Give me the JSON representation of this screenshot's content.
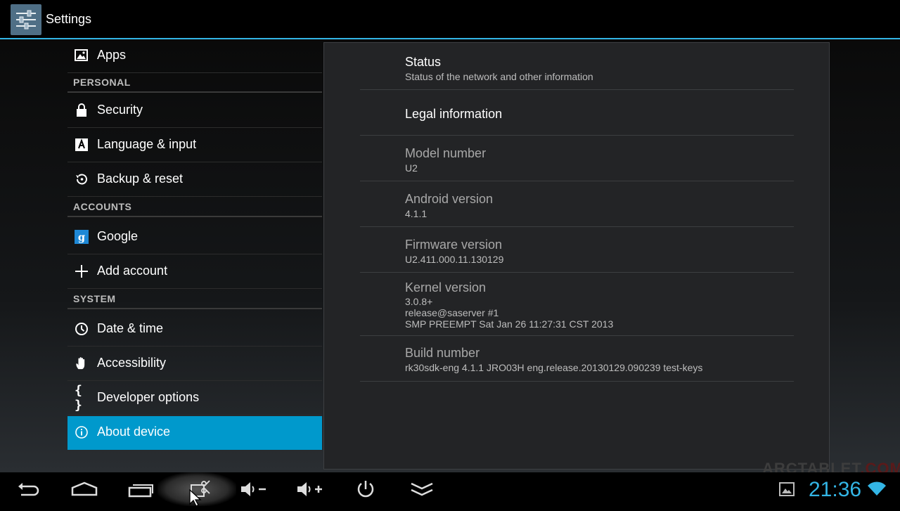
{
  "action_bar": {
    "title": "Settings"
  },
  "nav": {
    "apps": "Apps",
    "sections": {
      "personal": "PERSONAL",
      "accounts": "ACCOUNTS",
      "system": "SYSTEM"
    },
    "security": "Security",
    "language": "Language & input",
    "backup": "Backup & reset",
    "google": "Google",
    "add_account": "Add account",
    "date_time": "Date & time",
    "accessibility": "Accessibility",
    "developer": "Developer options",
    "about": "About device"
  },
  "about": {
    "status": {
      "title": "Status",
      "summary": "Status of the network and other information"
    },
    "legal": {
      "title": "Legal information"
    },
    "model": {
      "title": "Model number",
      "summary": "U2"
    },
    "android": {
      "title": "Android version",
      "summary": "4.1.1"
    },
    "firmware": {
      "title": "Firmware version",
      "summary": "U2.411.000.11.130129"
    },
    "kernel": {
      "title": "Kernel version",
      "summary": "3.0.8+\nrelease@saserver #1\nSMP PREEMPT Sat Jan 26 11:27:31 CST 2013"
    },
    "build": {
      "title": "Build number",
      "summary": "rk30sdk-eng 4.1.1 JRO03H eng.release.20130129.090239 test-keys"
    }
  },
  "status_bar": {
    "time": "21:36"
  },
  "watermark": {
    "name": "ARCTABLET",
    "tld": ".COM"
  },
  "colors": {
    "accent": "#33b5e5",
    "selected": "#0099cc"
  }
}
